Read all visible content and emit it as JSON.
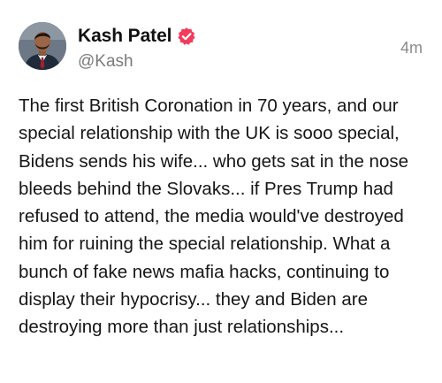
{
  "post": {
    "author": {
      "display_name": "Kash Patel",
      "handle": "@Kash",
      "verified": true,
      "avatar_icon": "profile-photo"
    },
    "timestamp": "4m",
    "text": "The first British Coronation in 70 years, and our special relationship with the UK is sooo special, Bidens sends his wife... who gets sat in the nose bleeds behind the Slovaks... if Pres Trump had refused to attend, the media would've destroyed him for ruining the special relationship. What a bunch of fake news mafia hacks, continuing to display their hypocrisy... they and Biden are destroying more than just relationships..."
  },
  "colors": {
    "verified_badge": "#f23c5c",
    "handle": "#7a7a7a",
    "timestamp": "#8a8a8a",
    "text": "#161616"
  }
}
